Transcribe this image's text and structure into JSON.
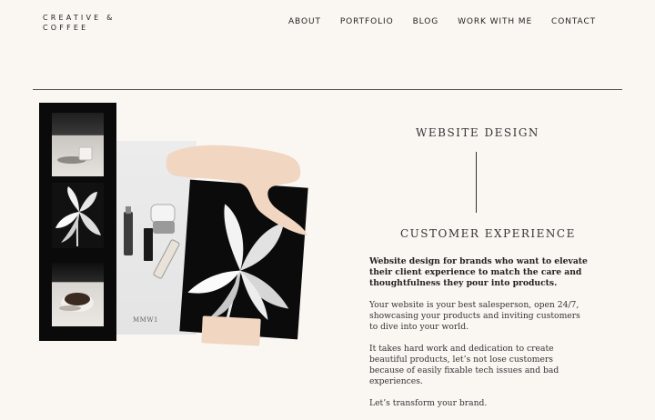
{
  "brand": {
    "line1": "CREATIVE &",
    "line2": "COFFEE"
  },
  "nav": {
    "items": [
      {
        "label": "ABOUT"
      },
      {
        "label": "PORTFOLIO"
      },
      {
        "label": "BLOG"
      },
      {
        "label": "WORK WITH ME"
      },
      {
        "label": "CONTACT"
      }
    ]
  },
  "collage": {
    "product_label": "MMW1"
  },
  "content": {
    "heading_top": "WEBSITE DESIGN",
    "heading_bottom": "CUSTOMER EXPERIENCE",
    "lead": "Website design for brands who want to elevate their client experience to match the care and thoughtfulness they pour into products.",
    "p1": "Your website is your best salesperson, open 24/7, showcasing your products and inviting customers to dive into your world.",
    "p2": "It takes hard work and dedication to create beautiful products, let’s not lose customers because of easily fixable tech issues and bad experiences.",
    "p3": "Let’s transform your brand."
  },
  "colors": {
    "background": "#faf7f3",
    "accent_peach": "#f1d6c1",
    "text": "#222222"
  }
}
